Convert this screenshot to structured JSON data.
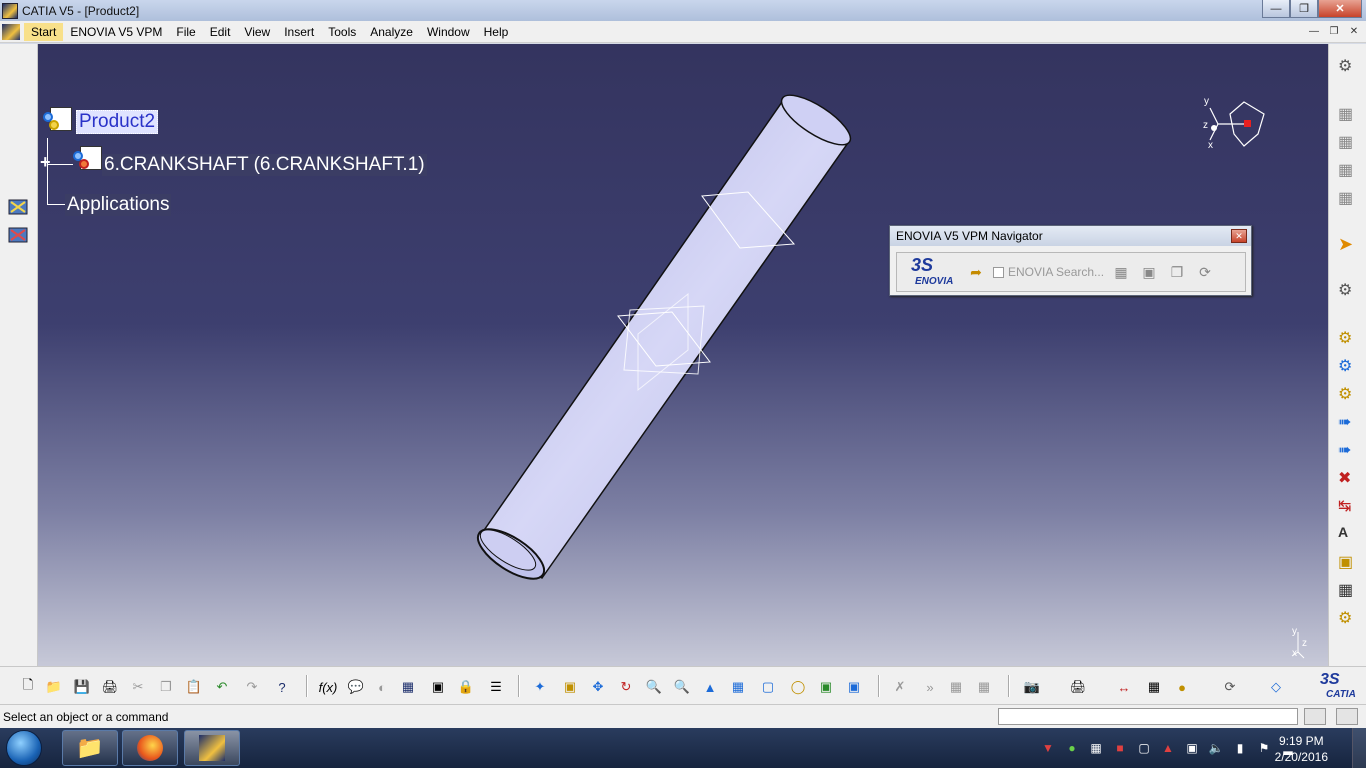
{
  "window": {
    "title": "CATIA V5 - [Product2]"
  },
  "menu": {
    "items": [
      "Start",
      "ENOVIA V5 VPM",
      "File",
      "Edit",
      "View",
      "Insert",
      "Tools",
      "Analyze",
      "Window",
      "Help"
    ],
    "active": "Start"
  },
  "tree": {
    "root": "Product2",
    "child": "6.CRANKSHAFT (6.CRANKSHAFT.1)",
    "applications": "Applications"
  },
  "navigator": {
    "title": "ENOVIA V5 VPM Navigator",
    "logo_mark": "3S",
    "logo_text": "ENOVIA",
    "search_label": "ENOVIA Search..."
  },
  "compass": {
    "x": "x",
    "y": "y",
    "z": "z"
  },
  "axis_labels": {
    "x": "x",
    "y": "y",
    "z": "z"
  },
  "brand": {
    "text": "CATIA",
    "mark": "3S"
  },
  "status": {
    "prompt": "Select an object or a command",
    "command_value": ""
  },
  "taskbar": {
    "time": "9:19 PM",
    "date": "2/20/2016"
  },
  "colors": {
    "viewport_top": "#34345f",
    "viewport_bottom": "#c7c9d8",
    "selection": "#2a32c8",
    "part": "#c9c9f0"
  }
}
